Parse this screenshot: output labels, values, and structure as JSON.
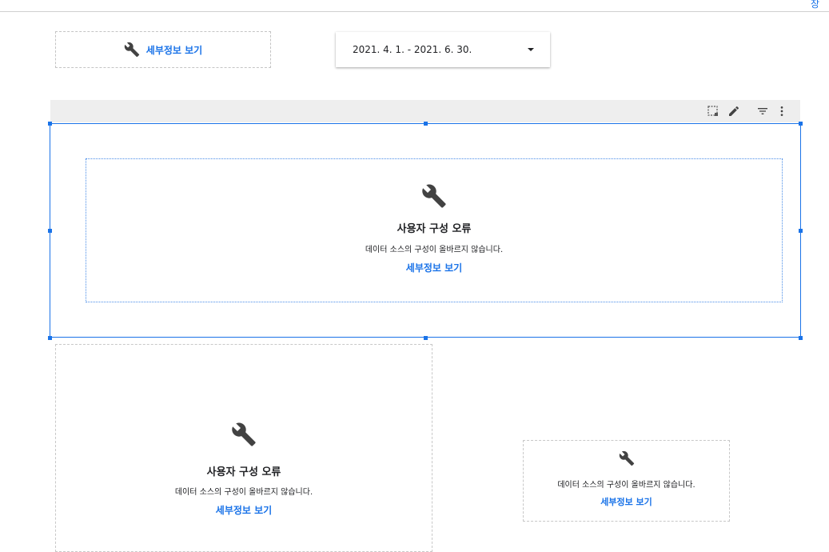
{
  "header": {
    "corner_text": "장"
  },
  "top_chip": {
    "link": "세부정보 보기",
    "icon": "wrench-icon"
  },
  "date_range": {
    "value": "2021. 4. 1. - 2021. 6. 30.",
    "icon": "caret-down-icon"
  },
  "toolbar": {
    "icons": [
      "select-area-icon",
      "edit-icon",
      "filter-icon",
      "more-vert-icon"
    ]
  },
  "main_error": {
    "icon": "wrench-icon",
    "title": "사용자 구성 오류",
    "description": "데이터 소스의 구성이 올바르지 않습니다.",
    "link": "세부정보 보기"
  },
  "left_error": {
    "icon": "wrench-icon",
    "title": "사용자 구성 오류",
    "description": "데이터 소스의 구성이 올바르지 않습니다.",
    "link": "세부정보 보기"
  },
  "right_error": {
    "icon": "wrench-icon",
    "description": "데이터 소스의 구성이 올바르지 않습니다.",
    "link": "세부정보 보기"
  },
  "colors": {
    "accent": "#1a73e8",
    "icon": "#424242",
    "toolbar_bg": "#eeeeee"
  }
}
